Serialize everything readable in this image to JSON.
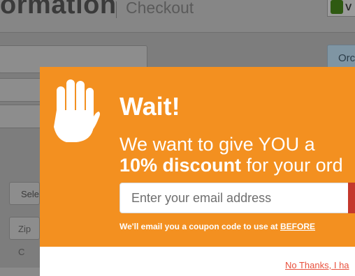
{
  "background": {
    "title": "ormation",
    "subtitle": "Checkout",
    "secure_letter": "V",
    "select_label": "Sele",
    "zip_label": "Zip C",
    "tab_label": "Orc"
  },
  "popup": {
    "headline": "Wait!",
    "line1": "We want to give YOU a",
    "line2_bold": "10% discount",
    "line2_rest": " for your ord",
    "email_placeholder": "Enter your email address",
    "note_prefix": "We'll email you a coupon code to use at ",
    "note_emphasis": "BEFORE",
    "no_thanks": "No Thanks, I ha",
    "icon": "hand-stop-icon",
    "colors": {
      "accent": "#f39020",
      "button": "#c4382c",
      "link": "#e8503c"
    }
  }
}
